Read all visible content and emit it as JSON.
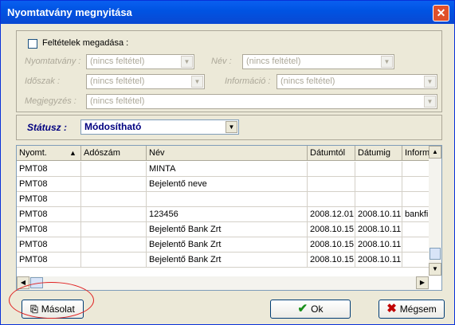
{
  "window": {
    "title": "Nyomtatvány megnyitása",
    "close_icon": "close-icon"
  },
  "filters": {
    "checkbox_label": "Feltételek megadása :",
    "nyomtatvany": {
      "label": "Nyomtatvány :",
      "value": "(nincs feltétel)"
    },
    "nev": {
      "label": "Név :",
      "value": "(nincs feltétel)"
    },
    "idoszak": {
      "label": "Időszak :",
      "value": "(nincs feltétel)"
    },
    "informacio": {
      "label": "Információ :",
      "value": "(nincs feltétel)"
    },
    "megjegyzes": {
      "label": "Megjegyzés :",
      "value": "(nincs feltétel)"
    }
  },
  "status": {
    "label": "Státusz :",
    "value": "Módosítható"
  },
  "table": {
    "headers": {
      "nyomt": "Nyomt.",
      "adoszam": "Adószám",
      "nev": "Név",
      "datumtol": "Dátumtól",
      "datumig": "Dátumig",
      "info": "Informá"
    },
    "sort_indicator": "▲",
    "rows": [
      {
        "nyomt": "PMT08",
        "adoszam": "",
        "nev": "MINTA",
        "datumtol": "",
        "datumig": "",
        "info": ""
      },
      {
        "nyomt": "PMT08",
        "adoszam": "",
        "nev": "Bejelentő neve",
        "datumtol": "",
        "datumig": "",
        "info": ""
      },
      {
        "nyomt": "PMT08",
        "adoszam": "",
        "nev": "",
        "datumtol": "",
        "datumig": "",
        "info": ""
      },
      {
        "nyomt": "PMT08",
        "adoszam": "",
        "nev": "123456",
        "datumtol": "2008.12.01",
        "datumig": "2008.10.11",
        "info": "bankfi"
      },
      {
        "nyomt": "PMT08",
        "adoszam": "",
        "nev": "Bejelentő Bank Zrt",
        "datumtol": "2008.10.15",
        "datumig": "2008.10.11",
        "info": ""
      },
      {
        "nyomt": "PMT08",
        "adoszam": "",
        "nev": "Bejelentő Bank Zrt",
        "datumtol": "2008.10.15",
        "datumig": "2008.10.11",
        "info": ""
      },
      {
        "nyomt": "PMT08",
        "adoszam": "",
        "nev": "Bejelentő Bank Zrt",
        "datumtol": "2008.10.15",
        "datumig": "2008.10.11",
        "info": ""
      }
    ]
  },
  "buttons": {
    "masolat": "Másolat",
    "ok": "Ok",
    "megsem": "Mégsem"
  },
  "colors": {
    "titlebar": "#0054E3",
    "annotation": "#E02020",
    "status_text": "#000080"
  }
}
